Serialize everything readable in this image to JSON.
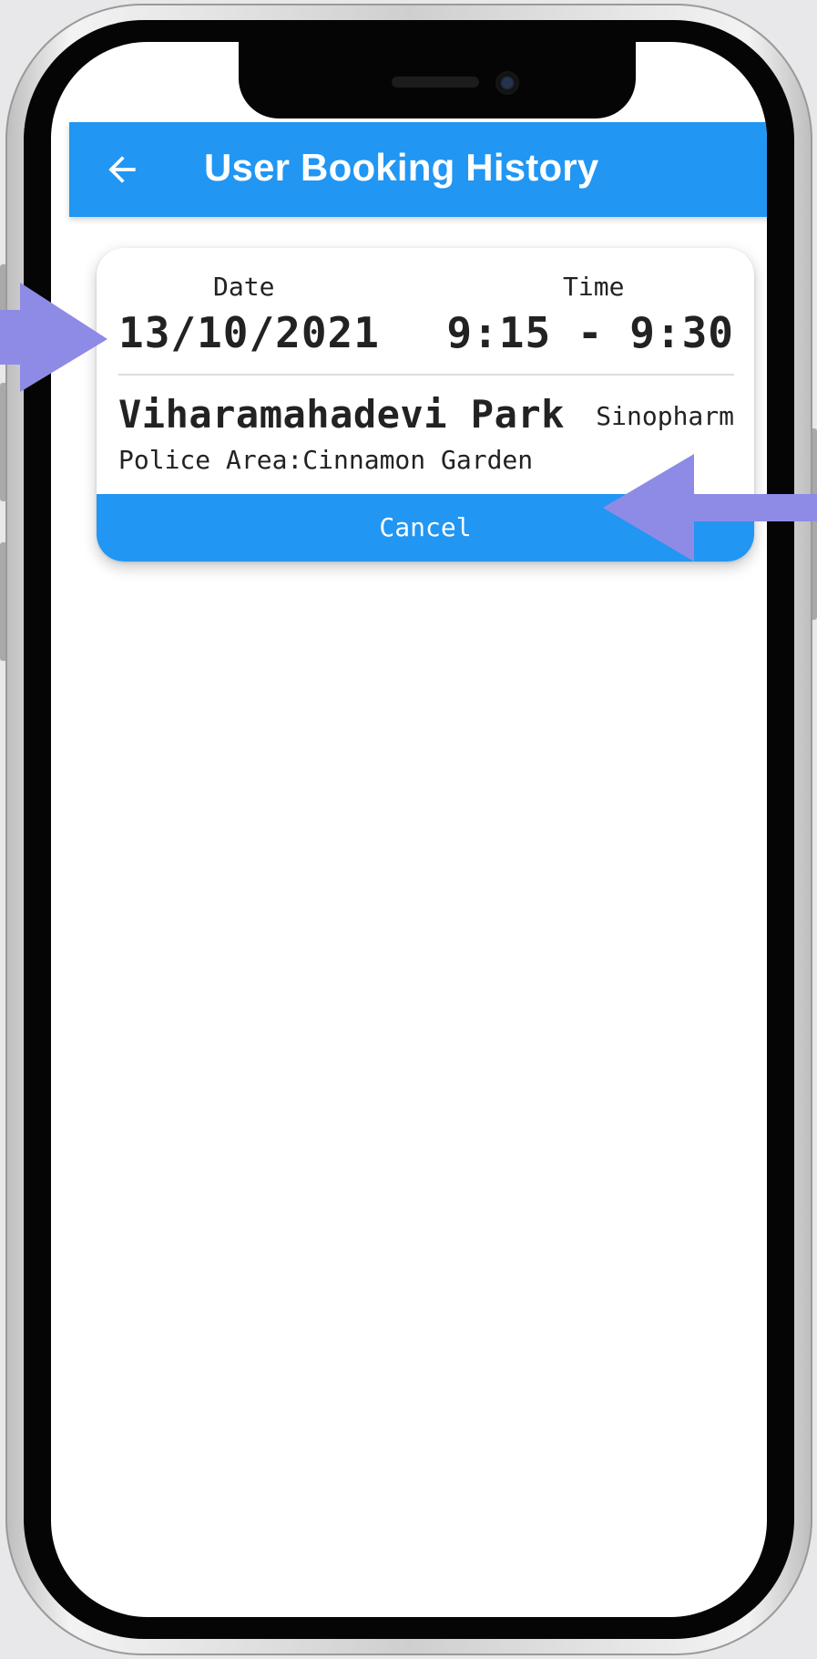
{
  "app_bar": {
    "title": "User Booking History",
    "back_icon": "arrow-back-icon",
    "color": "#2196f3"
  },
  "booking": {
    "date_label": "Date",
    "time_label": "Time",
    "date": "13/10/2021",
    "time": "9:15 - 9:30",
    "location": "Viharamahadevi Park",
    "vaccine": "Sinopharm",
    "police_area": "Police Area:Cinnamon Garden",
    "cancel_label": "Cancel"
  },
  "annotations": {
    "arrow_color": "#8e8be6"
  }
}
